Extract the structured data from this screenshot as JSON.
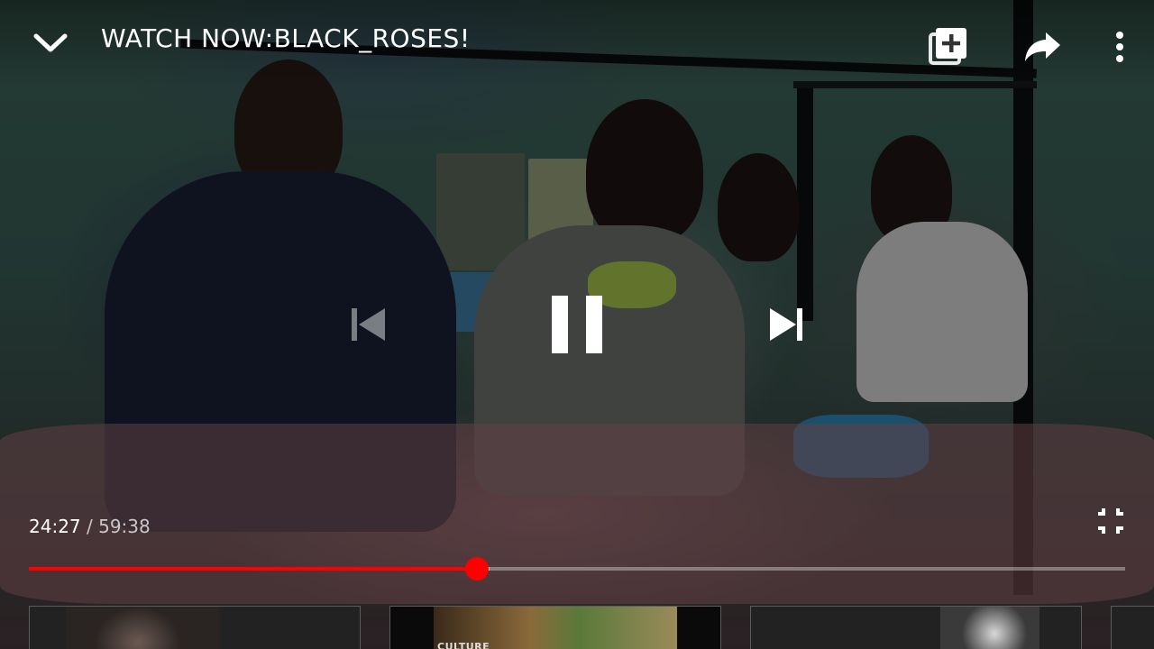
{
  "player": {
    "title": "WATCH NOW:BLACK_ROSES!",
    "current_time": "24:27",
    "separator": " / ",
    "total_time": "59:38",
    "progress": 0.409,
    "buffered": 0.42,
    "state": "playing"
  },
  "icons": {
    "collapse": "chevron-down-icon",
    "add_to_playlist": "add-to-playlist-icon",
    "share": "share-icon",
    "more": "more-vertical-icon",
    "previous": "skip-previous-icon",
    "pause": "pause-icon",
    "next": "skip-next-icon",
    "exit_fullscreen": "exit-fullscreen-icon"
  },
  "colors": {
    "accent": "#ff0000",
    "text": "#ffffff"
  },
  "suggestions": [
    {
      "label": ""
    },
    {
      "label": "CULTURE"
    },
    {
      "label": ""
    },
    {
      "label": ""
    }
  ]
}
